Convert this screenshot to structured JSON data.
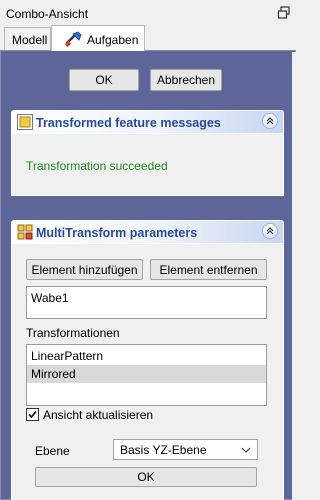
{
  "window": {
    "title": "Combo-Ansicht"
  },
  "tabs": [
    {
      "label": "Modell"
    },
    {
      "label": "Aufgaben"
    }
  ],
  "dialog": {
    "ok_label": "OK",
    "cancel_label": "Abbrechen"
  },
  "messages_box": {
    "title": "Transformed feature messages",
    "status": "Transformation succeeded",
    "status_color": "#1f8a1f"
  },
  "params_box": {
    "title": "MultiTransform parameters",
    "add_label": "Element hinzufügen",
    "remove_label": "Element entfernen",
    "features": [
      "Wabe1"
    ],
    "transformations_label": "Transformationen",
    "transformations": [
      "LinearPattern",
      "Mirrored"
    ],
    "update_view_label": "Ansicht aktualisieren",
    "update_view_checked": true,
    "plane_label": "Ebene",
    "plane_value": "Basis YZ-Ebene",
    "plane_ok_label": "OK"
  },
  "colors": {
    "panel_bg": "#5e6598",
    "box_title": "#2a4b98"
  }
}
